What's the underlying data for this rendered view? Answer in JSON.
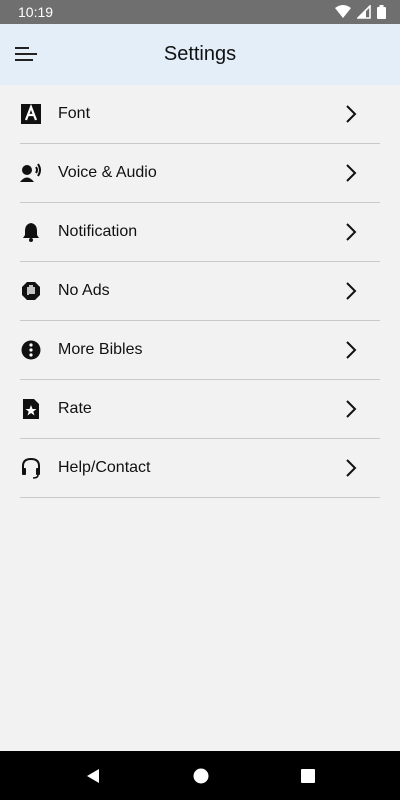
{
  "status_bar": {
    "time": "10:19",
    "icons": [
      "wifi-icon",
      "cell-signal-icon",
      "battery-icon"
    ]
  },
  "app_bar": {
    "title": "Settings",
    "menu_icon": "menu-icon",
    "background_color": "#e3eef8"
  },
  "settings": {
    "items": [
      {
        "label": "Font",
        "icon": "font-icon"
      },
      {
        "label": "Voice & Audio",
        "icon": "voice-icon"
      },
      {
        "label": "Notification",
        "icon": "bell-icon"
      },
      {
        "label": "No Ads",
        "icon": "hand-stop-icon"
      },
      {
        "label": "More Bibles",
        "icon": "info-more-icon"
      },
      {
        "label": "Rate",
        "icon": "star-document-icon"
      },
      {
        "label": "Help/Contact",
        "icon": "headset-icon"
      }
    ],
    "chevron_icon": "chevron-right-icon"
  },
  "nav_bar": {
    "buttons": [
      "back-icon",
      "home-icon",
      "recents-icon"
    ]
  }
}
